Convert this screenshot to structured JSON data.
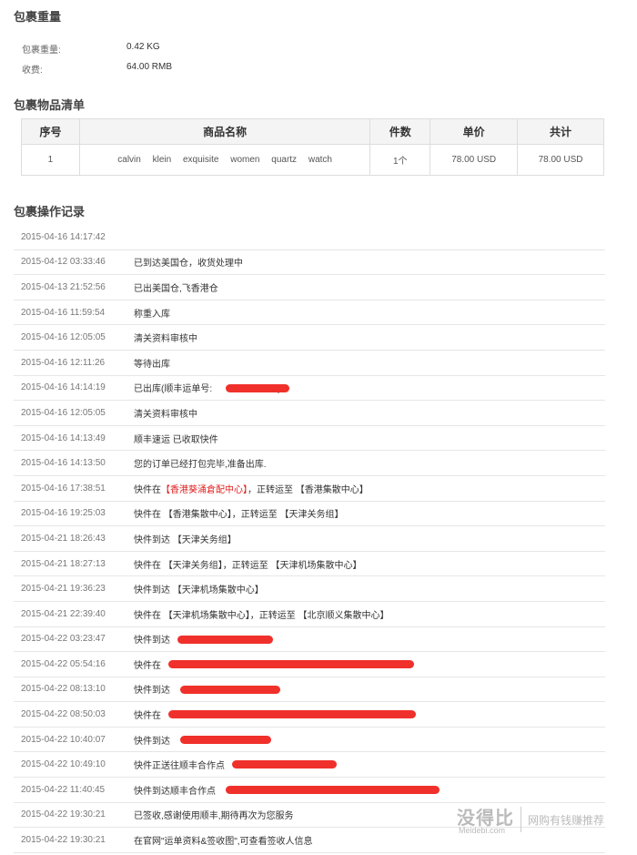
{
  "weight_section": {
    "title": "包裹重量",
    "weight_label": "包裹重量:",
    "weight_value": "0.42 KG",
    "fee_label": "收费:",
    "fee_value": "64.00 RMB"
  },
  "items_section": {
    "title": "包裹物品清单",
    "headers": [
      "序号",
      "商品名称",
      "件数",
      "单价",
      "共计"
    ],
    "rows": [
      {
        "index": "1",
        "name_words": [
          "calvin",
          "klein",
          "exquisite",
          "women",
          "quartz",
          "watch"
        ],
        "qty": "1个",
        "unit_price": "78.00 USD",
        "total": "78.00 USD"
      }
    ]
  },
  "log_section": {
    "title": "包裹操作记录",
    "rows": [
      {
        "time": "2015-04-16 14:17:42",
        "text": ""
      },
      {
        "time": "2015-04-12 03:33:46",
        "text": "已到达美国仓，收货处理中"
      },
      {
        "time": "2015-04-13 21:52:56",
        "text": "已出美国仓,飞香港仓"
      },
      {
        "time": "2015-04-16 11:59:54",
        "text": "称重入库"
      },
      {
        "time": "2015-04-16 12:05:05",
        "text": "清关资料审核中"
      },
      {
        "time": "2015-04-16 12:11:26",
        "text": "等待出库"
      },
      {
        "time": "2015-04-16 14:14:19",
        "text": "已出库(顺丰运单号:",
        "text_after": ")"
      },
      {
        "time": "2015-04-16 12:05:05",
        "text": "清关资料审核中"
      },
      {
        "time": "2015-04-16 14:13:49",
        "text": "顺丰速运 已收取快件"
      },
      {
        "time": "2015-04-16 14:13:50",
        "text": "您的订单已经打包完毕,准备出库."
      },
      {
        "time": "2015-04-16 17:38:51",
        "text": "快件在",
        "highlight": "【香港葵涌倉配中心】",
        "text_after": "，正转运至 【香港集散中心】"
      },
      {
        "time": "2015-04-16 19:25:03",
        "text": "快件在 【香港集散中心】，正转运至 【天津关务组】"
      },
      {
        "time": "2015-04-21 18:26:43",
        "text": "快件到达 【天津关务组】"
      },
      {
        "time": "2015-04-21 18:27:13",
        "text": "快件在 【天津关务组】，正转运至 【天津机场集散中心】"
      },
      {
        "time": "2015-04-21 19:36:23",
        "text": "快件到达 【天津机场集散中心】"
      },
      {
        "time": "2015-04-21 22:39:40",
        "text": "快件在 【天津机场集散中心】，正转运至 【北京顺义集散中心】"
      },
      {
        "time": "2015-04-22 03:23:47",
        "text": "快件到达"
      },
      {
        "time": "2015-04-22 05:54:16",
        "text": "快件在"
      },
      {
        "time": "2015-04-22 08:13:10",
        "text": "快件到达"
      },
      {
        "time": "2015-04-22 08:50:03",
        "text": "快件在"
      },
      {
        "time": "2015-04-22 10:40:07",
        "text": "快件到达"
      },
      {
        "time": "2015-04-22 10:49:10",
        "text": "快件正送往顺丰合作点"
      },
      {
        "time": "2015-04-22 11:40:45",
        "text": "快件到达顺丰合作点"
      },
      {
        "time": "2015-04-22 19:30:21",
        "text": "已签收,感谢使用顺丰,期待再次为您服务"
      },
      {
        "time": "2015-04-22 19:30:21",
        "text": "在官网\"运单资料&签收图\",可查看签收人信息"
      }
    ]
  },
  "watermark": {
    "brand": "没得比",
    "domain": "Meidebi.com",
    "slogan": "网购有钱赚推荐"
  },
  "colors": {
    "highlight": "#e02020",
    "redaction": "#f0302a"
  }
}
